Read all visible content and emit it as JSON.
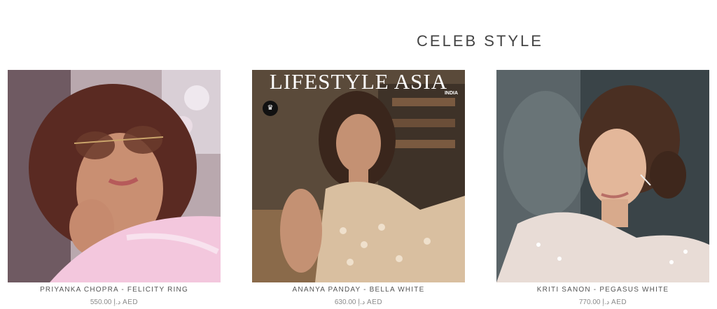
{
  "section": {
    "title": "CELEB STYLE"
  },
  "products": [
    {
      "name": "PRIYANKA CHOPRA - FELICITY RING",
      "price": "550.00 د.إ AED",
      "image_icon": "photo-priyanka-chopra"
    },
    {
      "name": "ANANYA PANDAY - BELLA WHITE",
      "price": "630.00 د.إ AED",
      "image_icon": "photo-ananya-panday"
    },
    {
      "name": "KRITI SANON - PEGASUS WHITE",
      "price": "770.00 د.إ AED",
      "image_icon": "photo-kriti-sanon"
    }
  ],
  "magazine": {
    "title": "LIFESTYLE ASIA",
    "subtitle": "INDIA"
  }
}
